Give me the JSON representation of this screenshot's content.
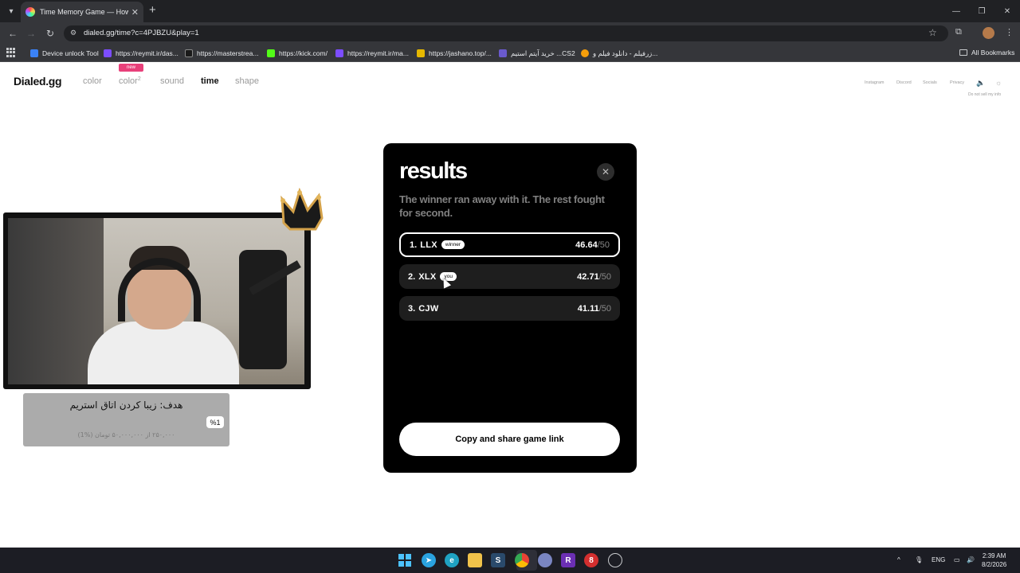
{
  "browser": {
    "tab_title": "Time Memory Game — How Go",
    "url": "dialed.gg/time?c=4PJBZU&play=1",
    "bookmarks": [
      {
        "label": "Device unlock Tool",
        "color": "#3b82f6"
      },
      {
        "label": "https://reymit.ir/das...",
        "color": "#7c4dff"
      },
      {
        "label": "https://masterstrea...",
        "color": "#1a1a1a"
      },
      {
        "label": "https://kick.com/",
        "color": "#53fc18"
      },
      {
        "label": "https://reymit.ir/ma...",
        "color": "#7c4dff"
      },
      {
        "label": "https://jashano.top/...",
        "color": "#e6b800"
      },
      {
        "label": "خرید آیتم استیم ...CS2",
        "color": "#6a5acd"
      },
      {
        "label": "زرفیلم - دانلود فیلم و...",
        "color": "#f59e0b"
      }
    ],
    "all_bookmarks": "All Bookmarks"
  },
  "site": {
    "logo": "Dialed.gg",
    "nav": {
      "color": "color",
      "color2": "color",
      "color2_sup": "2",
      "new_badge": "new",
      "sound": "sound",
      "time": "time",
      "shape": "shape"
    },
    "top_links": {
      "instagram": "Instagram",
      "discord": "Discord",
      "socials": "Socials",
      "privacy": "Privacy",
      "do_not_sell": "Do not sell my info"
    }
  },
  "overlay": {
    "goal_title": "هدف: زیبا کردن اتاق استریم",
    "goal_percent": "%1",
    "goal_progress": "۲۵۰,۰۰۰ از ۵۰,۰۰۰,۰۰۰ تومان (%1)"
  },
  "modal": {
    "title": "results",
    "subtitle": "The winner ran away with it. The rest fought for second.",
    "results": [
      {
        "rank": "1.",
        "name": "LLX",
        "tag": "winner",
        "score": "46.64",
        "max": "/50"
      },
      {
        "rank": "2.",
        "name": "XLX",
        "tag": "you",
        "score": "42.71",
        "max": "/50"
      },
      {
        "rank": "3.",
        "name": "CJW",
        "tag": "",
        "score": "41.11",
        "max": "/50"
      }
    ],
    "share_button": "Copy and share game link"
  },
  "taskbar": {
    "lang": "ENG",
    "time": "2:39 AM",
    "date": "8/2/2026"
  }
}
